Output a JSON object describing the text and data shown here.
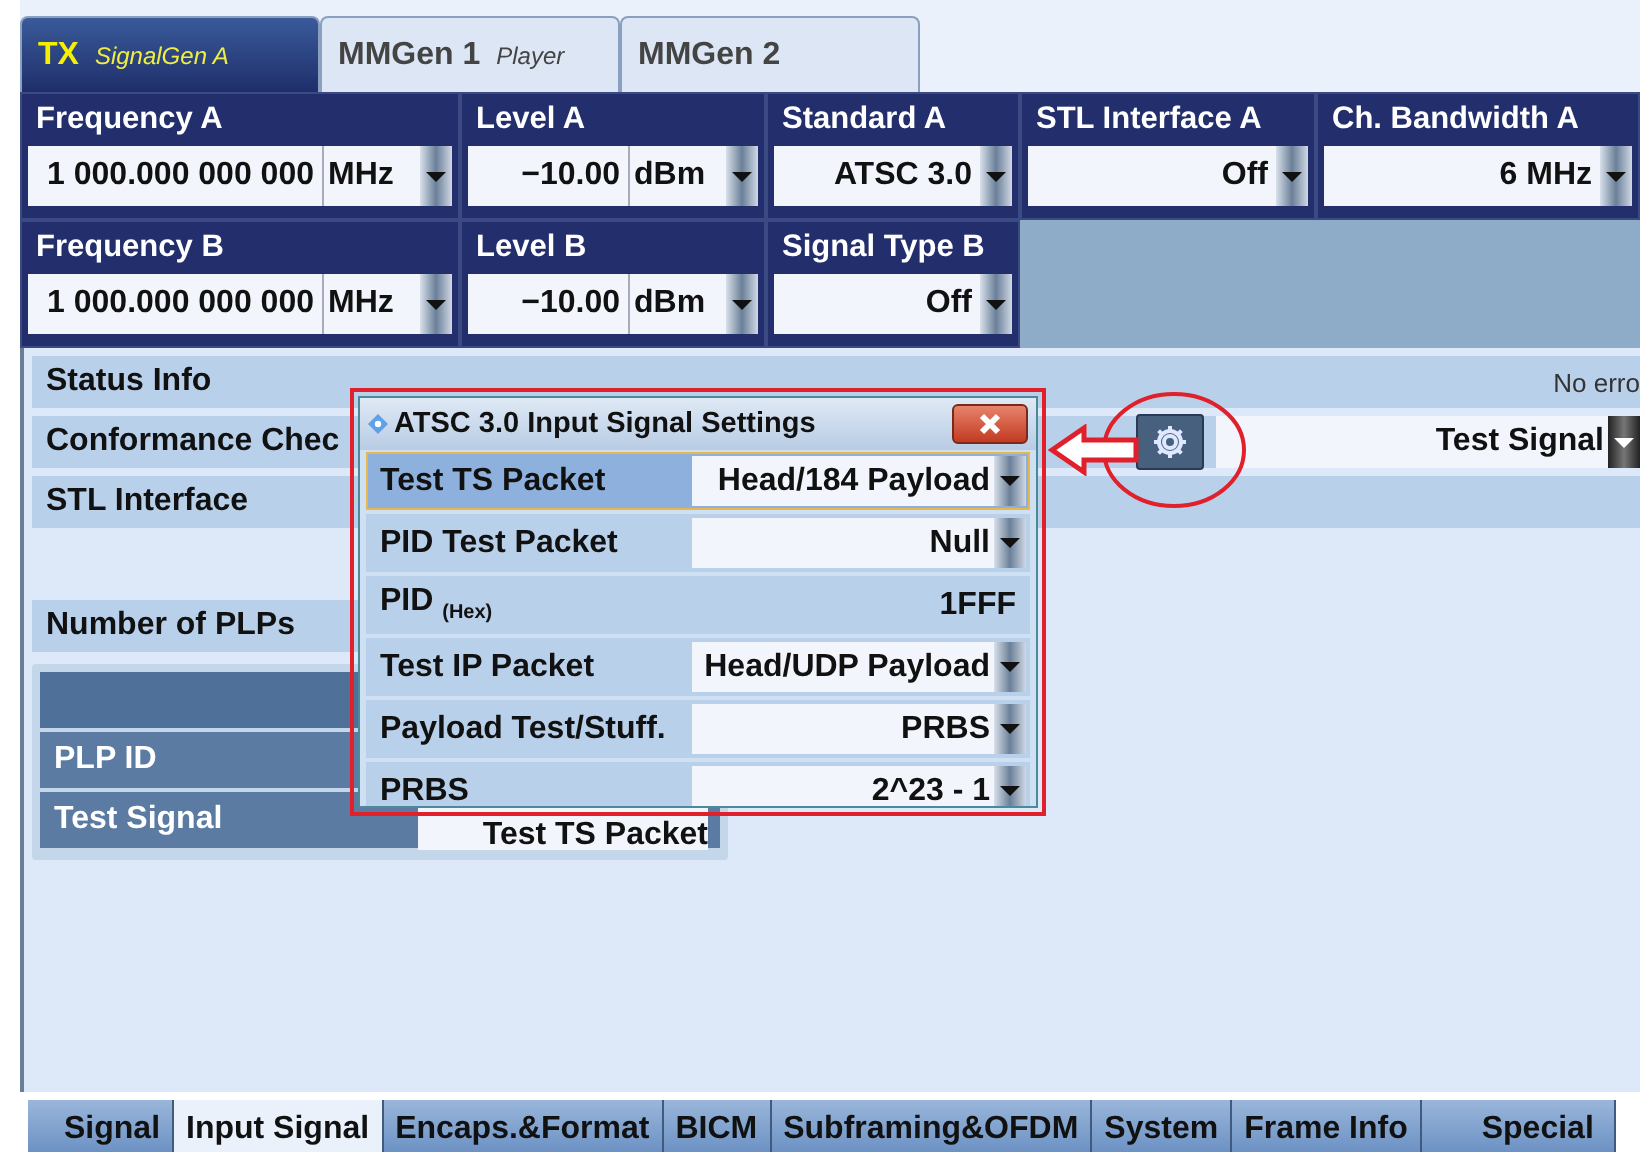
{
  "tabs": [
    {
      "label": "TX",
      "sublabel": "SignalGen A",
      "selected": true
    },
    {
      "label": "MMGen 1",
      "sublabel": "Player",
      "selected": false
    },
    {
      "label": "MMGen 2",
      "selected": false
    }
  ],
  "parameters": [
    [
      {
        "label": "Frequency A",
        "value": "1 000.000 000 000",
        "unit": "MHz"
      },
      {
        "label": "Level A",
        "value": "−10.00",
        "unit": "dBm"
      },
      {
        "label": "Standard A",
        "value": "ATSC 3.0"
      },
      {
        "label": "STL Interface A",
        "value": "Off"
      },
      {
        "label": "Ch. Bandwidth A",
        "value": "6 MHz"
      }
    ],
    [
      {
        "label": "Frequency B",
        "value": "1 000.000 000 000",
        "unit": "MHz"
      },
      {
        "label": "Level B",
        "value": "−10.00",
        "unit": "dBm"
      },
      {
        "label": "Signal Type B",
        "value": "Off"
      }
    ]
  ],
  "status_rows": [
    {
      "label": "Status Info",
      "value": "No erro"
    },
    {
      "label": "Conformance Chec",
      "dropdown": "Test Signal"
    },
    {
      "label": "STL Interface"
    }
  ],
  "number_of_plps": {
    "label": "Number of PLPs"
  },
  "plp_table": {
    "rows": [
      {
        "label": "PLP ID"
      },
      {
        "label": "Test Signal",
        "value": "Test TS Packet"
      }
    ]
  },
  "dialog": {
    "title": "ATSC 3.0 Input Signal Settings",
    "rows": [
      {
        "label": "Test TS Packet",
        "kind": "dropdown",
        "value": "Head/184 Payload",
        "selected": true
      },
      {
        "label": "PID Test Packet",
        "kind": "dropdown",
        "value": "Null",
        "selected": false
      },
      {
        "label": "PID $_{(Hex)}$",
        "kind": "readout",
        "value": "1FFF",
        "selected": false
      },
      {
        "label": "Test IP Packet",
        "kind": "dropdown",
        "value": "Head/UDP Payload",
        "selected": false
      },
      {
        "label": "Payload Test/Stuff.",
        "kind": "dropdown",
        "value": "PRBS",
        "selected": false
      },
      {
        "label": "PRBS",
        "kind": "dropdown",
        "value": "2^23 - 1",
        "selected": false
      }
    ]
  },
  "bottom_tabs": [
    {
      "label": "Signal",
      "selected": false
    },
    {
      "label": "Input Signal",
      "selected": true
    },
    {
      "label": "Encaps.&Format",
      "selected": false
    },
    {
      "label": "BICM",
      "selected": false
    },
    {
      "label": "Subframing&OFDM",
      "selected": false
    },
    {
      "label": "System",
      "selected": false
    },
    {
      "label": "Frame Info",
      "selected": false
    },
    {
      "label": "Special",
      "selected": false
    }
  ]
}
